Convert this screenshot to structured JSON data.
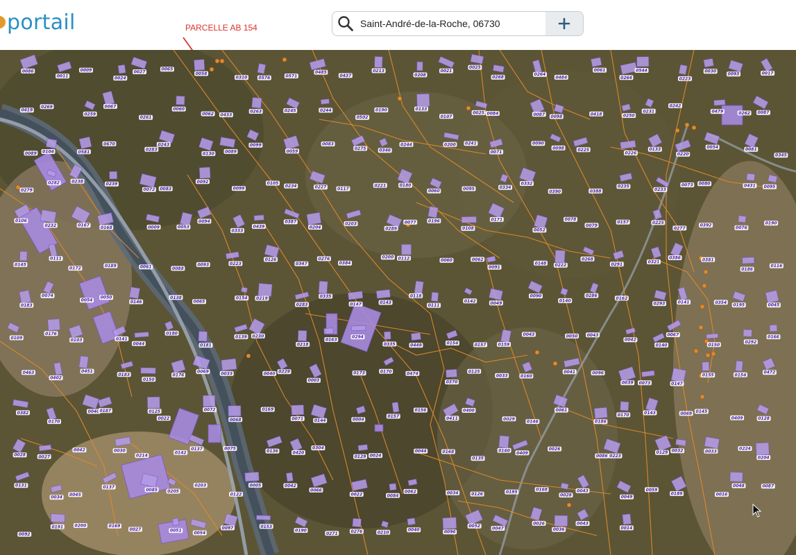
{
  "brand": {
    "name": "portail"
  },
  "annotation": {
    "label": "PARCELLE AB 154"
  },
  "search": {
    "value": "Saint-André-de-la-Roche, 06730",
    "add_symbol": "+"
  },
  "map": {
    "parcel_labels": [
      "0086",
      "0011",
      "0009",
      "0024",
      "0027",
      "0065",
      "0058",
      "0310",
      "0576",
      "0571",
      "0485",
      "0437",
      "0213",
      "0208",
      "0021",
      "0025",
      "0268",
      "0264",
      "0484",
      "0061",
      "0264",
      "0544",
      "0223",
      "0030",
      "0093",
      "0017",
      "0419",
      "0269",
      "0259",
      "0067",
      "0261",
      "0060",
      "0062",
      "0433",
      "0263",
      "0245",
      "0244",
      "0502",
      "0190",
      "0133",
      "0107",
      "0025",
      "0084",
      "0087",
      "0098",
      "0418",
      "0250",
      "0231",
      "0242",
      "0479",
      "0262",
      "0087",
      "0089",
      "0104",
      "0581",
      "0670",
      "0283",
      "0243",
      "0130",
      "0089",
      "0099",
      "0059",
      "0083",
      "0275",
      "0346",
      "0244",
      "0200",
      "0241",
      "0071",
      "0090",
      "0098",
      "0225",
      "0226",
      "0133",
      "0220",
      "0054",
      "0081",
      "0345",
      "0279",
      "0282",
      "0238",
      "0239",
      "0072",
      "0083",
      "0092",
      "0099",
      "0105",
      "0234",
      "0227",
      "0117",
      "0221",
      "0180",
      "0060",
      "0095",
      "0334",
      "0332",
      "0390",
      "0388",
      "0235",
      "0233",
      "0073",
      "0080",
      "0431",
      "0095",
      "0106",
      "0232",
      "0167",
      "0168",
      "0009",
      "0053",
      "0094",
      "0333",
      "0439",
      "0387",
      "0204",
      "0203",
      "0289",
      "0077",
      "0196",
      "0108",
      "0171",
      "0052",
      "0078",
      "0079",
      "0157",
      "0225",
      "0277",
      "0392",
      "0076",
      "0190",
      "0145",
      "0111",
      "0172",
      "0189",
      "0061",
      "0088",
      "0093",
      "0223",
      "0126",
      "0347",
      "0276",
      "0384",
      "0200",
      "0112",
      "0060",
      "0062",
      "0091",
      "0148",
      "0222",
      "0268",
      "0291",
      "0321",
      "0386",
      "0381",
      "0186",
      "0116",
      "0183",
      "0074",
      "0054",
      "0050",
      "0146",
      "0138",
      "0065",
      "0154",
      "0219",
      "0283",
      "0335",
      "0147",
      "0143",
      "0118",
      "0111",
      "0142",
      "0049",
      "0090",
      "0140",
      "0286",
      "0162",
      "0293",
      "0141",
      "0354",
      "0195",
      "0045",
      "0109",
      "0176",
      "0103",
      "0141",
      "0044",
      "0180",
      "0181",
      "0139",
      "0230",
      "0218",
      "0163",
      "0294",
      "0335",
      "0449",
      "0154",
      "0157",
      "0159",
      "0043",
      "0050",
      "0043",
      "0042",
      "0140",
      "0067",
      "0150",
      "0292",
      "0166",
      "0463",
      "0402",
      "0451",
      "0183",
      "0150",
      "0176",
      "0069",
      "0033",
      "0040",
      "0229",
      "0003",
      "0173",
      "0170",
      "0474",
      "0370",
      "0125",
      "0033",
      "0160",
      "0041",
      "0096",
      "0039",
      "0073",
      "0147",
      "0155",
      "0154",
      "0472",
      "0382",
      "0170",
      "0040",
      "0187",
      "0125",
      "0022",
      "0072",
      "0068",
      "0169",
      "0071",
      "0144",
      "0004",
      "0157",
      "0156",
      "0411",
      "0400",
      "0029",
      "0146",
      "0061",
      "0186",
      "0170",
      "0143",
      "0069",
      "0145",
      "0409",
      "0128",
      "0028",
      "0027",
      "0042",
      "0030",
      "0214",
      "0142",
      "0137",
      "0075",
      "0136",
      "0420",
      "0304",
      "0129",
      "0024",
      "0044",
      "0168",
      "0135",
      "0160",
      "0409",
      "0026",
      "0086",
      "0223",
      "0129",
      "0032",
      "0033",
      "0224",
      "0204",
      "0131",
      "0034",
      "0045",
      "0137",
      "0085",
      "0205",
      "0203",
      "0122",
      "0005",
      "0042",
      "0066",
      "0022",
      "0084",
      "0062",
      "0034",
      "0126",
      "0195",
      "0168",
      "0028",
      "0043",
      "0049",
      "0059",
      "0189",
      "0016",
      "0048",
      "0087",
      "0092",
      "0191",
      "0200",
      "0169",
      "0027",
      "0051",
      "0054",
      "0097",
      "0153",
      "0190",
      "0271",
      "0276",
      "0210",
      "0040",
      "0096",
      "0052",
      "0047",
      "0026",
      "0036",
      "0043",
      "0014"
    ]
  }
}
